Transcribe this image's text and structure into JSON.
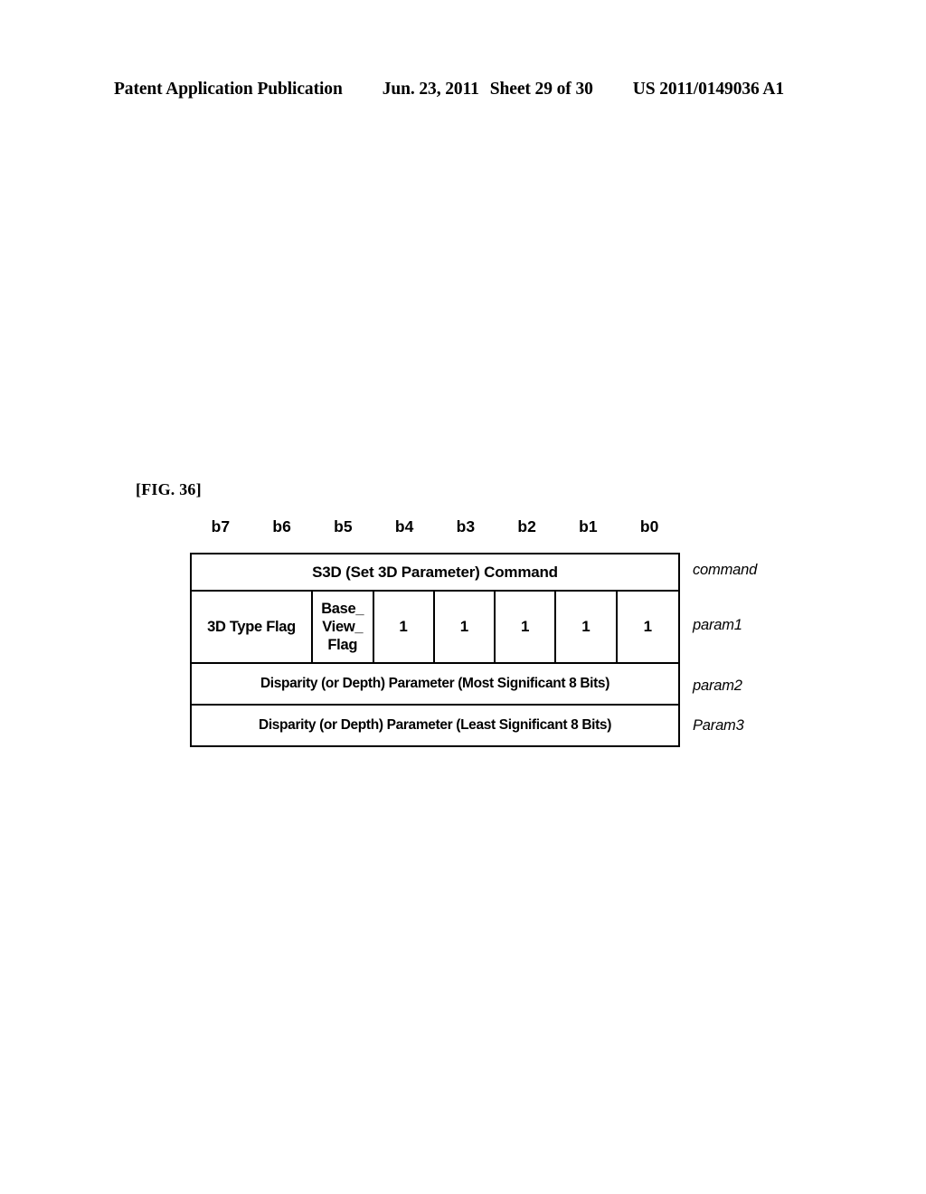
{
  "header": {
    "publication": "Patent Application Publication",
    "date": "Jun. 23, 2011",
    "sheet": "Sheet 29 of 30",
    "patent_number": "US 2011/0149036 A1"
  },
  "figure": {
    "label": "[FIG. 36]",
    "bit_headers": [
      "b7",
      "b6",
      "b5",
      "b4",
      "b3",
      "b2",
      "b1",
      "b0"
    ],
    "rows": [
      {
        "side_label": "command",
        "type": "full",
        "text": "S3D (Set 3D Parameter) Command"
      },
      {
        "side_label": "param1",
        "type": "bits",
        "cells": [
          {
            "text": "3D Type Flag",
            "span": 2
          },
          {
            "lines": [
              "Base_",
              "View_",
              "Flag"
            ],
            "span": 1
          },
          {
            "text": "1",
            "span": 1
          },
          {
            "text": "1",
            "span": 1
          },
          {
            "text": "1",
            "span": 1
          },
          {
            "text": "1",
            "span": 1
          },
          {
            "text": "1",
            "span": 1
          }
        ]
      },
      {
        "side_label": "param2",
        "type": "full",
        "text": "Disparity (or Depth) Parameter (Most Significant 8 Bits)"
      },
      {
        "side_label": "Param3",
        "type": "full",
        "text": "Disparity (or Depth) Parameter (Least Significant 8 Bits)"
      }
    ]
  }
}
